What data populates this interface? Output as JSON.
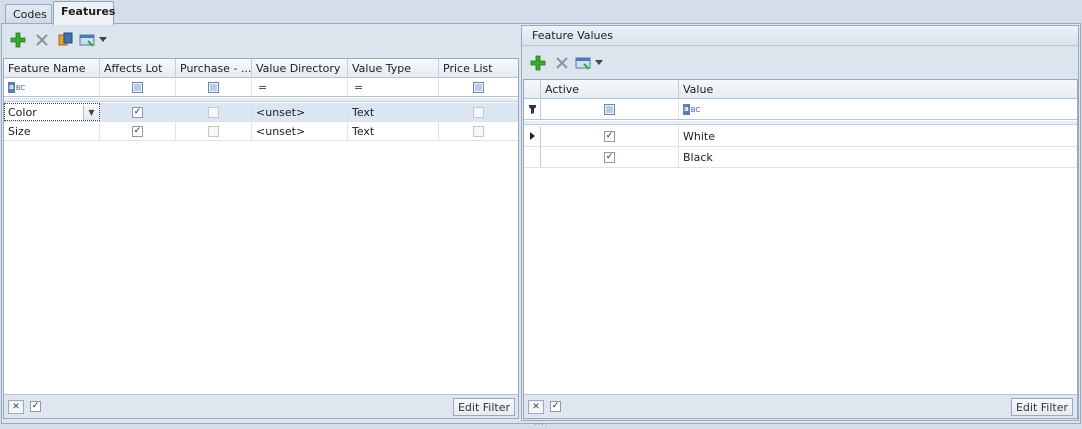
{
  "tabs": [
    {
      "label": "Codes",
      "active": false
    },
    {
      "label": "Features",
      "active": true
    }
  ],
  "features_grid": {
    "columns": [
      "Feature Name",
      "Affects Lot",
      "Purchase - ...",
      "Value Directory",
      "Value Type",
      "Price List"
    ],
    "filter_row": {
      "text_icon": "abc-filter-icon",
      "eq": "="
    },
    "rows": [
      {
        "feature_name": "Color",
        "affects_lot": true,
        "purchase": false,
        "value_directory": "<unset>",
        "value_type": "Text",
        "price_list": false,
        "selected": true
      },
      {
        "feature_name": "Size",
        "affects_lot": true,
        "purchase": false,
        "value_directory": "<unset>",
        "value_type": "Text",
        "price_list": false,
        "selected": false
      }
    ],
    "footer": {
      "edit_filter_label": "Edit Filter"
    }
  },
  "feature_values": {
    "title": "Feature Values",
    "columns": [
      "Active",
      "Value"
    ],
    "rows": [
      {
        "active": true,
        "value": "White",
        "current": true
      },
      {
        "active": true,
        "value": "Black",
        "current": false
      }
    ],
    "footer": {
      "edit_filter_label": "Edit Filter"
    }
  },
  "icons": {
    "add": "plus-icon",
    "delete": "x-icon",
    "copy": "copy-icon",
    "view": "view-icon",
    "dropdown": "chevron-down-icon"
  },
  "colors": {
    "add_green": "#3aa829",
    "selection": "#dbe6f5",
    "frame": "#9aaabd"
  }
}
